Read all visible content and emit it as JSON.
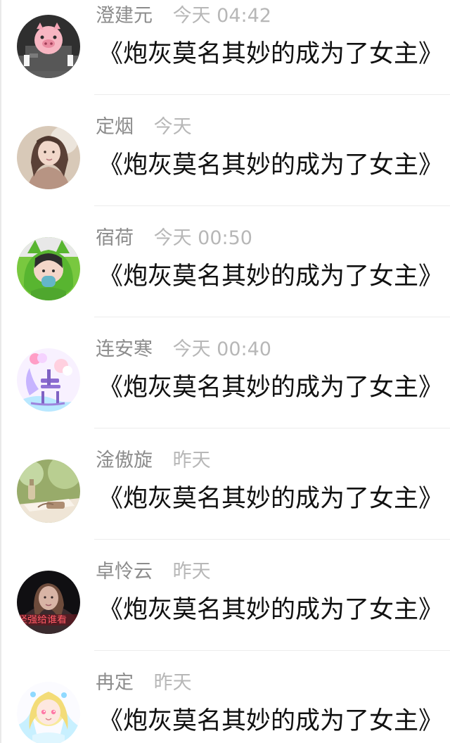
{
  "comments": [
    {
      "name": "澄建元",
      "time": "今天 04:42",
      "message": "《炮灰莫名其妙的成为了女主》",
      "avatar_icon": "pig-suit-avatar-icon"
    },
    {
      "name": "定烟",
      "time": "今天",
      "message": "《炮灰莫名其妙的成为了女主》",
      "avatar_icon": "girl-portrait-avatar-icon"
    },
    {
      "name": "宿荷",
      "time": "今天 00:50",
      "message": "《炮灰莫名其妙的成为了女主》",
      "avatar_icon": "green-cat-hood-avatar-icon"
    },
    {
      "name": "连安寒",
      "time": "今天 00:40",
      "message": "《炮灰莫名其妙的成为了女主》",
      "avatar_icon": "flower-chair-avatar-icon"
    },
    {
      "name": "淦傲旋",
      "time": "昨天",
      "message": "《炮灰莫名其妙的成为了女主》",
      "avatar_icon": "table-bottle-avatar-icon"
    },
    {
      "name": "卓怜云",
      "time": "昨天",
      "message": "《炮灰莫名其妙的成为了女主》",
      "avatar_icon": "dark-portrait-avatar-icon",
      "avatar_text": "坚强给谁看"
    },
    {
      "name": "冉定",
      "time": "昨天",
      "message": "《炮灰莫名其妙的成为了女主》",
      "avatar_icon": "anime-girl-avatar-icon"
    }
  ]
}
